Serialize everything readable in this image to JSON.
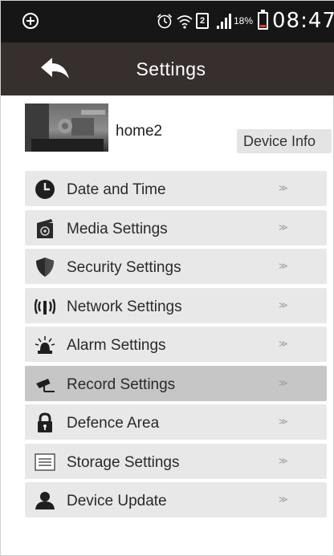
{
  "status_bar": {
    "battery_percent_text": "18%",
    "battery_level": 0.18,
    "sim_slot": "2",
    "time": "08:47",
    "icons": [
      "add-circle-icon",
      "alarm-clock-icon",
      "wifi-icon",
      "sim-icon",
      "signal-icon",
      "battery-icon"
    ]
  },
  "header": {
    "title": "Settings",
    "back_icon": "back-arrow-icon",
    "background_color": "#362f2e"
  },
  "device": {
    "name": "home2",
    "info_button_label": "Device Info"
  },
  "menu": {
    "chevron": "≫",
    "active_index": 5,
    "items": [
      {
        "label": "Date and Time",
        "icon": "clock-icon"
      },
      {
        "label": "Media Settings",
        "icon": "media-icon"
      },
      {
        "label": "Security Settings",
        "icon": "shield-icon"
      },
      {
        "label": "Network Settings",
        "icon": "network-signal-icon"
      },
      {
        "label": "Alarm Settings",
        "icon": "alarm-light-icon"
      },
      {
        "label": "Record Settings",
        "icon": "camera-record-icon"
      },
      {
        "label": "Defence Area",
        "icon": "lock-icon"
      },
      {
        "label": "Storage Settings",
        "icon": "storage-list-icon"
      },
      {
        "label": "Device Update",
        "icon": "user-update-icon"
      }
    ]
  },
  "colors": {
    "status_bar": "#161616",
    "menu_item": "#e8e8e8",
    "menu_item_active": "#c6c6c6",
    "battery_low": "#e8392a"
  }
}
